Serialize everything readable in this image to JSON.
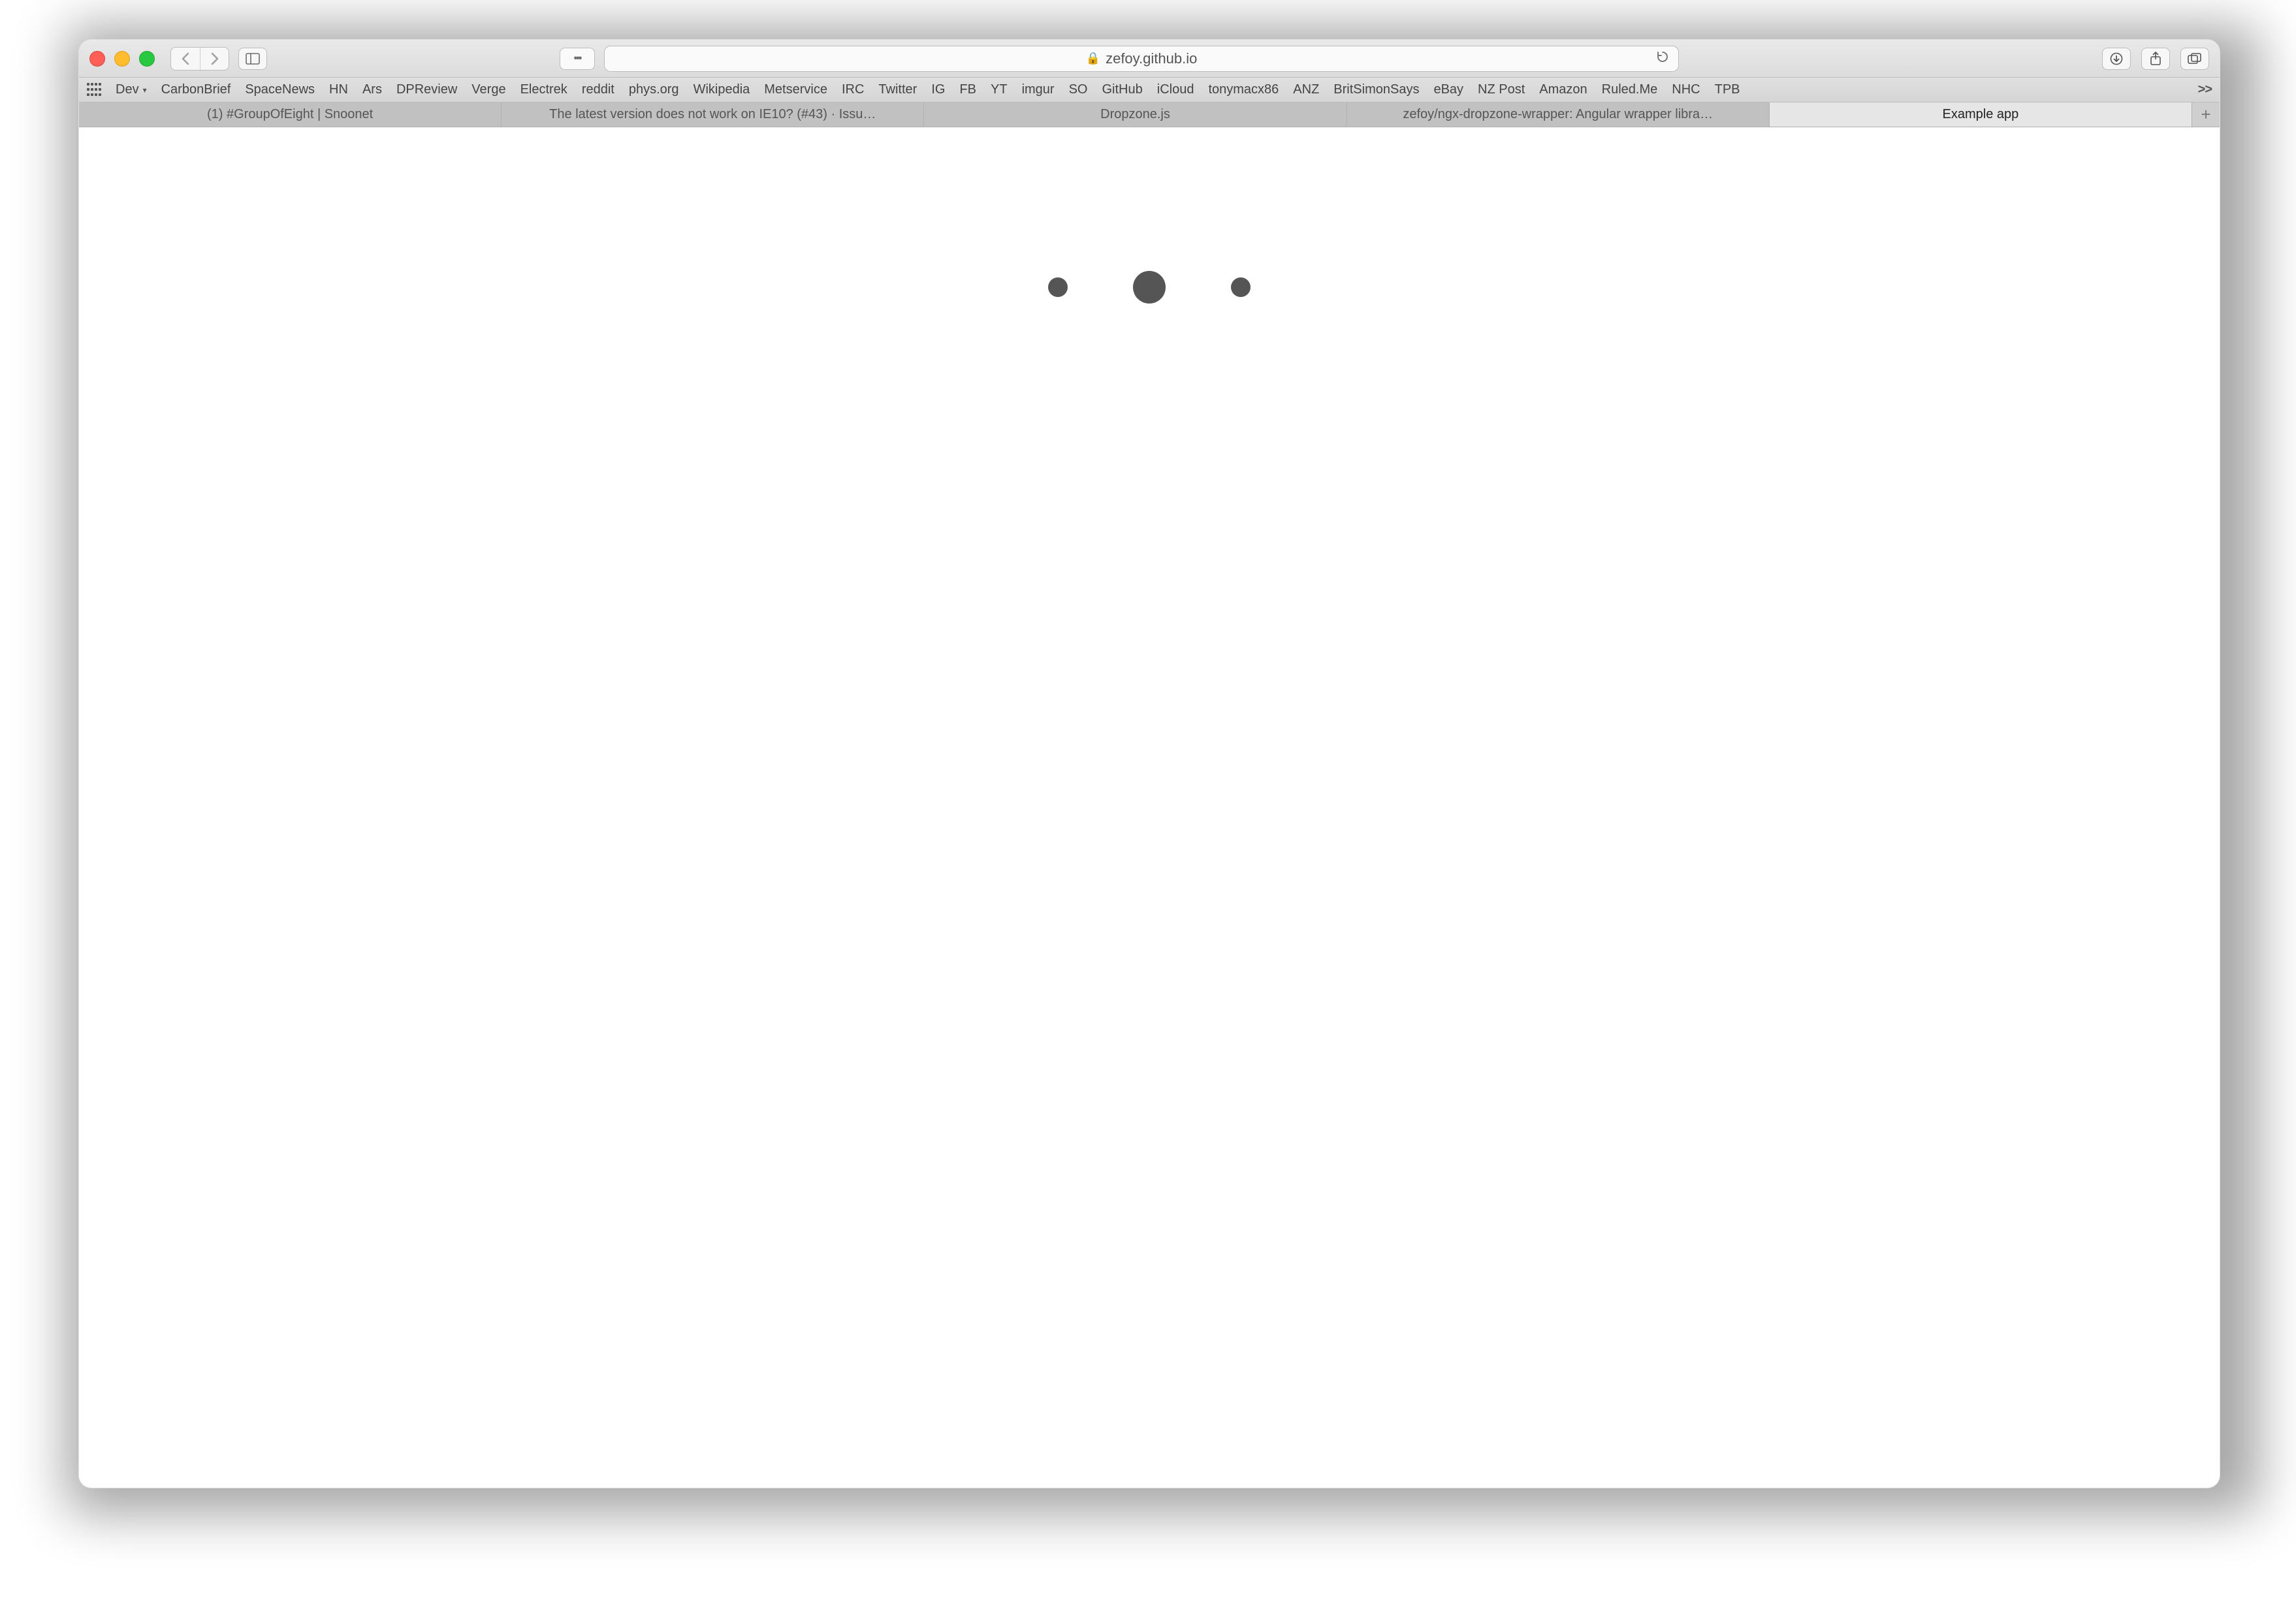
{
  "address": {
    "lock_glyph": "🔒",
    "host": "zefoy.github.io",
    "reload_glyph": "⟳"
  },
  "site_settings_glyph": "•••",
  "favorites": {
    "dev_label": "Dev",
    "items": [
      "CarbonBrief",
      "SpaceNews",
      "HN",
      "Ars",
      "DPReview",
      "Verge",
      "Electrek",
      "reddit",
      "phys.org",
      "Wikipedia",
      "Metservice",
      "IRC",
      "Twitter",
      "IG",
      "FB",
      "YT",
      "imgur",
      "SO",
      "GitHub",
      "iCloud",
      "tonymacx86",
      "ANZ",
      "BritSimonSays",
      "eBay",
      "NZ Post",
      "Amazon",
      "Ruled.Me",
      "NHC",
      "TPB"
    ],
    "overflow_glyph": ">>"
  },
  "tabs": [
    {
      "label": "(1) #GroupOfEight | Snoonet"
    },
    {
      "label": "The latest version does not work on IE10? (#43) · Issu…"
    },
    {
      "label": "Dropzone.js"
    },
    {
      "label": "zefoy/ngx-dropzone-wrapper: Angular wrapper libra…"
    },
    {
      "label": "Example app"
    }
  ],
  "active_tab_index": 4,
  "newtab_glyph": "+"
}
